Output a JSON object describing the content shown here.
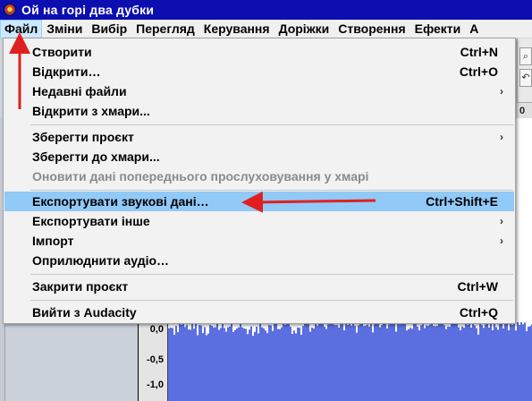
{
  "window": {
    "title": "Ой на горі два дубки"
  },
  "menubar": {
    "items": [
      {
        "label": "Файл",
        "active": true
      },
      {
        "label": "Зміни"
      },
      {
        "label": "Вибір"
      },
      {
        "label": "Перегляд"
      },
      {
        "label": "Керування"
      },
      {
        "label": "Доріжки"
      },
      {
        "label": "Створення"
      },
      {
        "label": "Ефекти"
      },
      {
        "label": "А"
      }
    ]
  },
  "file_menu": {
    "items": [
      {
        "label": "Створити",
        "shortcut": "Ctrl+N"
      },
      {
        "label": "Відкрити…",
        "shortcut": "Ctrl+O"
      },
      {
        "label": "Недавні файли",
        "submenu": true
      },
      {
        "label": "Відкрити з хмари..."
      },
      {
        "label": "Зберегти проєкт",
        "submenu": true
      },
      {
        "label": "Зберегти до хмари..."
      },
      {
        "label": "Оновити дані попереднього прослуховування у хмарі",
        "disabled": true
      },
      {
        "label": "Експортувати звукові дані…",
        "shortcut": "Ctrl+Shift+E",
        "highlighted": true
      },
      {
        "label": "Експортувати інше",
        "submenu": true
      },
      {
        "label": "Імпорт",
        "submenu": true
      },
      {
        "label": "Оприлюднити аудіо…"
      },
      {
        "label": "Закрити проєкт",
        "shortcut": "Ctrl+W"
      },
      {
        "label": "Вийти з Audacity",
        "shortcut": "Ctrl+Q"
      }
    ],
    "submenu_glyph": "›"
  },
  "track": {
    "vruler_ticks": [
      "0,0",
      "-0,5",
      "-1,0"
    ],
    "time_ruler_fragment": "0"
  },
  "toolbar": {
    "icons": [
      "zoom-icon",
      "undo-icon"
    ]
  },
  "colors": {
    "title_bg": "#0d0eb0",
    "highlight": "#91c9f7",
    "waveform": "#5b6fe0",
    "annotation": "#e02020"
  }
}
